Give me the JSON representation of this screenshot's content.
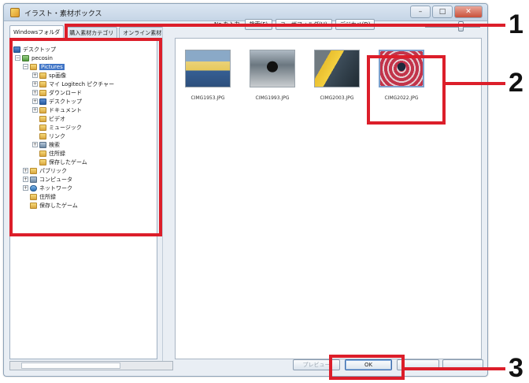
{
  "window": {
    "title": "イラスト・素材ボックス",
    "controls": {
      "minimize": "–",
      "maximize": "□",
      "close": "✕"
    }
  },
  "tabs": [
    {
      "label": "Windowsフォルダ",
      "active": true
    },
    {
      "label": "購入素材カテゴリ",
      "active": false
    },
    {
      "label": "オンライン素材",
      "active": false
    }
  ],
  "tree": {
    "items": [
      {
        "label": "デスクトップ",
        "icon": "desktop-icon",
        "expander": ""
      },
      {
        "label": "pecosin",
        "icon": "user-folder-icon",
        "expander": "−"
      },
      {
        "label": "Pictures",
        "icon": "folder-icon",
        "expander": "−",
        "selected": true
      },
      {
        "label": "sp画像",
        "icon": "folder-icon",
        "expander": "+"
      },
      {
        "label": "マイ Logitech ピクチャー",
        "icon": "folder-icon",
        "expander": "+"
      },
      {
        "label": "ダウンロード",
        "icon": "folder-icon",
        "expander": "+"
      },
      {
        "label": "デスクトップ",
        "icon": "desktop-icon",
        "expander": "+"
      },
      {
        "label": "ドキュメント",
        "icon": "folder-icon",
        "expander": "+"
      },
      {
        "label": "ビデオ",
        "icon": "folder-icon",
        "expander": ""
      },
      {
        "label": "ミュージック",
        "icon": "folder-icon",
        "expander": ""
      },
      {
        "label": "リンク",
        "icon": "folder-icon",
        "expander": ""
      },
      {
        "label": "検索",
        "icon": "search-folder-icon",
        "expander": "+"
      },
      {
        "label": "住所録",
        "icon": "folder-icon",
        "expander": ""
      },
      {
        "label": "保存したゲーム",
        "icon": "folder-icon",
        "expander": ""
      },
      {
        "label": "パブリック",
        "icon": "folder-icon",
        "expander": "+"
      },
      {
        "label": "コンピュータ",
        "icon": "computer-icon",
        "expander": "+"
      },
      {
        "label": "ネットワーク",
        "icon": "network-icon",
        "expander": "+"
      },
      {
        "label": "住所録",
        "icon": "folder-icon",
        "expander": ""
      },
      {
        "label": "保存したゲーム",
        "icon": "folder-icon",
        "expander": ""
      }
    ]
  },
  "toolbar": {
    "no_input": "No.を入力",
    "search": "検索(F)",
    "user_folder": "ユーザフォルダ(U)",
    "digital_camera": "デジカメ(D)"
  },
  "thumbnails": [
    {
      "caption": "CIMG1953.JPG",
      "selected": false
    },
    {
      "caption": "CIMG1993.JPG",
      "selected": false
    },
    {
      "caption": "CIMG2003.JPG",
      "selected": false
    },
    {
      "caption": "CIMG2022.JPG",
      "selected": true
    }
  ],
  "buttons": {
    "preview": "プレビュー",
    "ok": "OK",
    "cancel": "",
    "help": ""
  },
  "callouts": [
    "1",
    "2",
    "3"
  ],
  "colors": {
    "callout_red": "#dc1e2a",
    "selection_blue": "#3f74c6"
  }
}
